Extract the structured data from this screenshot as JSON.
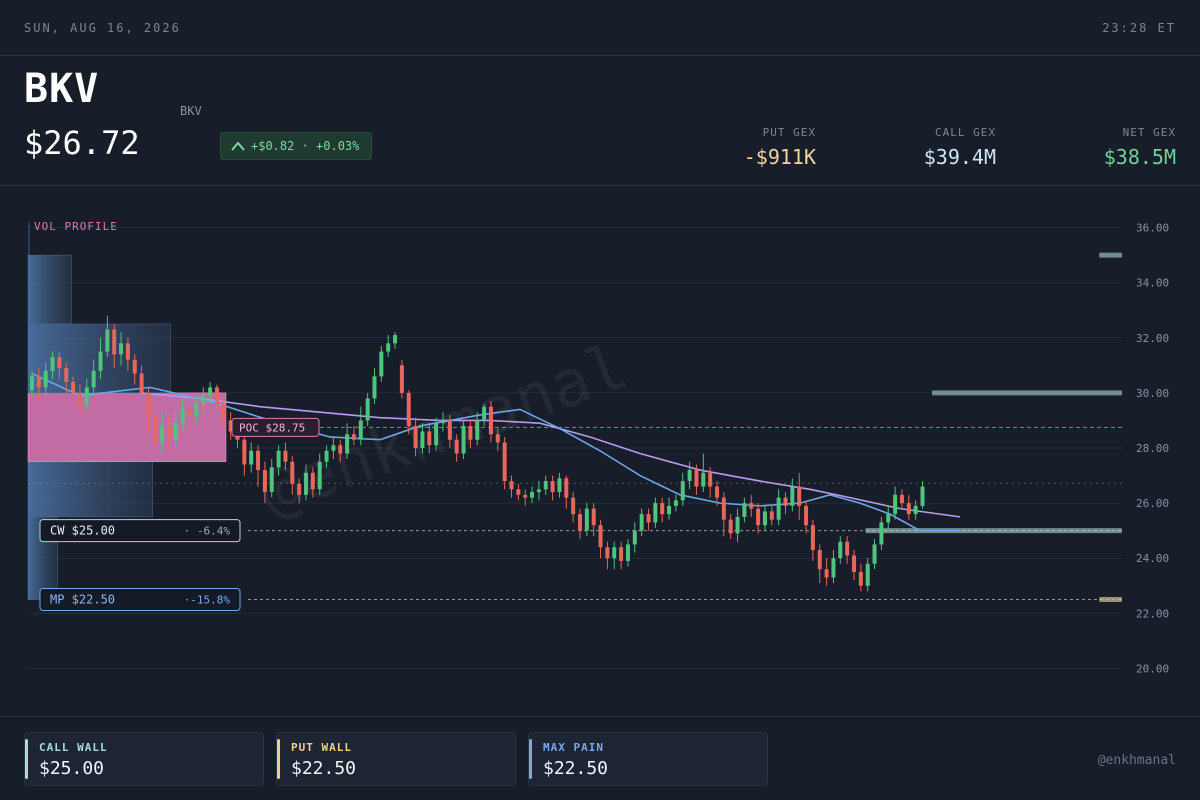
{
  "topbar": {
    "date": "SUN, AUG 16, 2026",
    "time": "23:28 ET"
  },
  "header": {
    "ticker": "BKV",
    "company": "BKV",
    "price": "$26.72",
    "change": "+$0.82 · +0.03%",
    "gex": [
      {
        "label": "PUT GEX",
        "value": "-$911K"
      },
      {
        "label": "CALL GEX",
        "value": "$39.4M"
      },
      {
        "label": "NET GEX",
        "value": "$38.5M"
      }
    ]
  },
  "footer": {
    "cards": [
      {
        "label": "CALL WALL",
        "value": "$25.00"
      },
      {
        "label": "PUT WALL",
        "value": "$22.50"
      },
      {
        "label": "MAX PAIN",
        "value": "$22.50"
      }
    ],
    "handle": "@enkhmanal"
  },
  "colors": {
    "up": "#4fc47f",
    "down": "#e8675c",
    "poc": "#e07ab8",
    "ma_fast": "#6aa7e8",
    "ma_slow": "#b89af0",
    "profile": "#4a6d9b"
  },
  "chart_data": {
    "type": "candlestick",
    "ylim": [
      19,
      37
    ],
    "y_ticks": [
      "20.00",
      "22.00",
      "24.00",
      "26.00",
      "28.00",
      "30.00",
      "32.00",
      "34.00",
      "36.00"
    ],
    "profile_label": "VOL PROFILE",
    "watermark": "@enkhmanal",
    "levels": [
      {
        "name": "poc",
        "label": "POC $28.75",
        "value": 28.75,
        "pct": ""
      },
      {
        "name": "cw",
        "label": "CW $25.00",
        "value": 25.0,
        "pct": "· -6.4%"
      },
      {
        "name": "mp",
        "label": "MP $22.50",
        "value": 22.5,
        "pct": "·-15.8%"
      }
    ],
    "last_price": 26.72,
    "volume_profile": [
      {
        "lo": 22.5,
        "hi": 25.5,
        "weight": 0.15
      },
      {
        "lo": 25.5,
        "hi": 27.5,
        "weight": 0.63
      },
      {
        "lo": 27.5,
        "hi": 30.0,
        "weight": 1.0
      },
      {
        "lo": 30.0,
        "hi": 32.5,
        "weight": 0.72
      },
      {
        "lo": 32.5,
        "hi": 35.0,
        "weight": 0.22
      }
    ],
    "gex_bars": [
      {
        "strike": 35.0,
        "magnitude": 0.12,
        "side": "call"
      },
      {
        "strike": 30.0,
        "magnitude": 1.0,
        "side": "call"
      },
      {
        "strike": 25.0,
        "magnitude": 1.35,
        "side": "call"
      },
      {
        "strike": 22.5,
        "magnitude": 0.12,
        "side": "put"
      }
    ],
    "candles": [
      [
        30.1,
        30.6,
        29.8,
        30.8
      ],
      [
        30.6,
        30.2,
        29.6,
        30.9
      ],
      [
        30.2,
        30.8,
        29.9,
        31.1
      ],
      [
        30.8,
        31.3,
        30.5,
        31.5
      ],
      [
        31.3,
        30.9,
        30.5,
        31.5
      ],
      [
        30.9,
        30.4,
        30.0,
        31.1
      ],
      [
        30.4,
        30.0,
        29.6,
        30.6
      ],
      [
        30.0,
        29.6,
        29.2,
        30.3
      ],
      [
        29.6,
        30.2,
        29.4,
        30.5
      ],
      [
        30.2,
        30.8,
        29.9,
        31.2
      ],
      [
        30.8,
        31.5,
        30.5,
        32.0
      ],
      [
        31.5,
        32.3,
        31.3,
        32.8
      ],
      [
        32.3,
        31.4,
        30.9,
        32.5
      ],
      [
        31.4,
        31.8,
        31.0,
        32.2
      ],
      [
        31.8,
        31.2,
        30.8,
        32.0
      ],
      [
        31.2,
        30.7,
        30.3,
        31.4
      ],
      [
        30.7,
        30.0,
        29.5,
        31.0
      ],
      [
        30.0,
        29.2,
        28.6,
        30.2
      ],
      [
        29.2,
        28.2,
        27.8,
        29.4
      ],
      [
        28.2,
        28.8,
        27.8,
        29.3
      ],
      [
        28.8,
        28.3,
        27.9,
        29.2
      ],
      [
        28.3,
        28.9,
        28.0,
        29.4
      ],
      [
        28.9,
        29.4,
        28.6,
        29.8
      ],
      [
        29.4,
        29.2,
        28.8,
        29.7
      ],
      [
        29.2,
        29.6,
        28.9,
        29.9
      ],
      [
        29.6,
        29.9,
        29.3,
        30.2
      ],
      [
        29.9,
        30.2,
        29.6,
        30.4
      ],
      [
        30.2,
        29.6,
        29.3,
        30.3
      ],
      [
        29.6,
        29.0,
        28.7,
        29.8
      ],
      [
        29.0,
        28.6,
        28.3,
        29.3
      ],
      [
        28.6,
        28.3,
        28.0,
        28.9
      ],
      [
        28.3,
        27.4,
        27.0,
        28.6
      ],
      [
        27.4,
        27.9,
        27.1,
        28.2
      ],
      [
        27.9,
        27.2,
        26.6,
        28.1
      ],
      [
        27.2,
        26.4,
        26.0,
        27.5
      ],
      [
        26.4,
        27.3,
        26.2,
        27.6
      ],
      [
        27.3,
        27.9,
        27.0,
        28.1
      ],
      [
        27.9,
        27.5,
        27.2,
        28.2
      ],
      [
        27.5,
        26.7,
        26.3,
        27.7
      ],
      [
        26.7,
        26.3,
        26.0,
        26.9
      ],
      [
        26.3,
        27.1,
        26.1,
        27.4
      ],
      [
        27.1,
        26.5,
        26.2,
        27.3
      ],
      [
        26.5,
        27.5,
        26.3,
        27.8
      ],
      [
        27.5,
        27.9,
        27.3,
        28.1
      ],
      [
        27.9,
        28.1,
        27.6,
        28.4
      ],
      [
        28.1,
        27.8,
        27.5,
        28.3
      ],
      [
        27.8,
        28.5,
        27.6,
        28.9
      ],
      [
        28.5,
        28.3,
        28.1,
        28.8
      ],
      [
        28.3,
        29.0,
        28.1,
        29.5
      ],
      [
        29.0,
        29.8,
        28.8,
        30.0
      ],
      [
        29.8,
        30.6,
        29.6,
        30.9
      ],
      [
        30.6,
        31.5,
        30.4,
        31.7
      ],
      [
        31.5,
        31.8,
        31.3,
        32.1
      ],
      [
        31.8,
        32.1,
        31.6,
        32.2
      ],
      [
        31.0,
        30.0,
        29.8,
        31.2
      ],
      [
        30.0,
        28.8,
        28.5,
        30.1
      ],
      [
        28.8,
        28.0,
        27.7,
        29.1
      ],
      [
        28.0,
        28.6,
        27.8,
        28.9
      ],
      [
        28.6,
        28.1,
        27.8,
        28.9
      ],
      [
        28.1,
        28.9,
        27.9,
        29.1
      ],
      [
        28.9,
        29.0,
        28.6,
        29.3
      ],
      [
        29.0,
        28.3,
        28.0,
        29.2
      ],
      [
        28.3,
        27.8,
        27.5,
        28.5
      ],
      [
        27.8,
        28.8,
        27.6,
        29.0
      ],
      [
        28.8,
        28.3,
        28.0,
        29.0
      ],
      [
        28.3,
        29.0,
        28.1,
        29.3
      ],
      [
        29.0,
        29.5,
        28.8,
        29.6
      ],
      [
        29.5,
        28.5,
        28.2,
        29.7
      ],
      [
        28.5,
        28.2,
        27.9,
        28.7
      ],
      [
        28.2,
        26.8,
        26.5,
        28.4
      ],
      [
        26.8,
        26.5,
        26.2,
        27.0
      ],
      [
        26.5,
        26.3,
        26.1,
        26.7
      ],
      [
        26.3,
        26.2,
        25.9,
        26.5
      ],
      [
        26.2,
        26.4,
        26.0,
        26.6
      ],
      [
        26.4,
        26.5,
        26.1,
        26.8
      ],
      [
        26.5,
        26.8,
        26.3,
        27.0
      ],
      [
        26.8,
        26.4,
        26.1,
        27.0
      ],
      [
        26.4,
        26.9,
        26.2,
        27.1
      ],
      [
        26.9,
        26.2,
        25.8,
        27.0
      ],
      [
        26.2,
        25.6,
        25.3,
        26.4
      ],
      [
        25.6,
        25.0,
        24.7,
        25.8
      ],
      [
        25.0,
        25.8,
        24.8,
        26.0
      ],
      [
        25.8,
        25.2,
        24.8,
        26.0
      ],
      [
        25.2,
        24.4,
        24.0,
        25.4
      ],
      [
        24.4,
        24.0,
        23.6,
        24.6
      ],
      [
        24.0,
        24.4,
        23.6,
        24.6
      ],
      [
        24.4,
        23.9,
        23.6,
        24.6
      ],
      [
        23.9,
        24.5,
        23.7,
        24.7
      ],
      [
        24.5,
        25.0,
        24.2,
        25.3
      ],
      [
        25.0,
        25.6,
        24.8,
        25.8
      ],
      [
        25.6,
        25.3,
        25.0,
        25.8
      ],
      [
        25.3,
        26.0,
        25.1,
        26.2
      ],
      [
        26.0,
        25.6,
        25.3,
        26.2
      ],
      [
        25.6,
        25.9,
        25.4,
        26.2
      ],
      [
        25.9,
        26.1,
        25.7,
        26.3
      ],
      [
        26.1,
        26.8,
        25.9,
        27.1
      ],
      [
        26.8,
        27.2,
        26.5,
        27.5
      ],
      [
        27.2,
        26.6,
        26.3,
        27.4
      ],
      [
        26.6,
        27.1,
        26.4,
        27.8
      ],
      [
        27.1,
        26.6,
        26.2,
        27.3
      ],
      [
        26.6,
        26.2,
        25.9,
        26.8
      ],
      [
        26.2,
        25.4,
        24.8,
        26.4
      ],
      [
        25.4,
        24.9,
        24.7,
        25.6
      ],
      [
        24.9,
        25.5,
        24.6,
        25.8
      ],
      [
        25.5,
        26.0,
        25.3,
        26.2
      ],
      [
        26.0,
        25.8,
        25.5,
        26.3
      ],
      [
        25.8,
        25.2,
        24.9,
        26.0
      ],
      [
        25.2,
        25.7,
        25.0,
        25.9
      ],
      [
        25.7,
        25.4,
        25.2,
        25.9
      ],
      [
        25.4,
        26.2,
        25.2,
        26.5
      ],
      [
        26.2,
        25.9,
        25.6,
        26.4
      ],
      [
        25.9,
        26.6,
        25.7,
        26.9
      ],
      [
        26.6,
        25.9,
        25.4,
        27.1
      ],
      [
        25.9,
        25.2,
        24.9,
        26.1
      ],
      [
        25.2,
        24.3,
        23.9,
        25.4
      ],
      [
        24.3,
        23.6,
        23.1,
        24.5
      ],
      [
        23.6,
        23.3,
        23.0,
        24.0
      ],
      [
        23.3,
        24.0,
        23.1,
        24.3
      ],
      [
        24.0,
        24.6,
        23.8,
        24.8
      ],
      [
        24.6,
        24.1,
        23.8,
        24.8
      ],
      [
        24.1,
        23.5,
        23.2,
        24.3
      ],
      [
        23.5,
        23.0,
        22.8,
        23.8
      ],
      [
        23.0,
        23.8,
        22.8,
        24.0
      ],
      [
        23.8,
        24.5,
        23.6,
        24.7
      ],
      [
        24.5,
        25.3,
        24.3,
        25.5
      ],
      [
        25.3,
        25.6,
        25.0,
        25.9
      ],
      [
        25.6,
        26.3,
        25.4,
        26.6
      ],
      [
        26.3,
        26.0,
        25.8,
        26.5
      ],
      [
        26.0,
        25.6,
        25.4,
        26.3
      ],
      [
        25.6,
        25.9,
        25.4,
        26.1
      ],
      [
        25.9,
        26.6,
        25.8,
        26.8
      ]
    ],
    "ma_fast": [
      [
        32,
        30.7
      ],
      [
        80,
        29.9
      ],
      [
        150,
        30.2
      ],
      [
        210,
        29.7
      ],
      [
        270,
        29.0
      ],
      [
        330,
        28.4
      ],
      [
        380,
        28.3
      ],
      [
        420,
        28.8
      ],
      [
        480,
        29.2
      ],
      [
        520,
        29.4
      ],
      [
        560,
        28.7
      ],
      [
        600,
        27.9
      ],
      [
        640,
        27.0
      ],
      [
        680,
        26.3
      ],
      [
        720,
        26.0
      ],
      [
        760,
        25.9
      ],
      [
        800,
        26.0
      ],
      [
        830,
        26.3
      ],
      [
        860,
        26.0
      ],
      [
        890,
        25.6
      ],
      [
        920,
        25.0
      ],
      [
        960,
        25.0
      ]
    ],
    "ma_slow": [
      [
        140,
        30.0
      ],
      [
        200,
        29.8
      ],
      [
        260,
        29.5
      ],
      [
        320,
        29.3
      ],
      [
        380,
        29.1
      ],
      [
        440,
        29.0
      ],
      [
        490,
        29.0
      ],
      [
        540,
        28.9
      ],
      [
        590,
        28.4
      ],
      [
        640,
        27.8
      ],
      [
        700,
        27.2
      ],
      [
        760,
        26.8
      ],
      [
        810,
        26.5
      ],
      [
        850,
        26.2
      ],
      [
        900,
        25.8
      ],
      [
        940,
        25.6
      ],
      [
        960,
        25.5
      ]
    ]
  }
}
